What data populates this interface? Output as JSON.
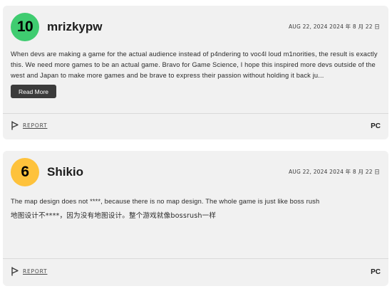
{
  "reviews": [
    {
      "score": "10",
      "score_color": "#3fcc70",
      "username": "mrizkypw",
      "date": "AUG 22, 2024  2024 年 8 月 22 日",
      "body": "When devs are making a game for the actual audience instead of p4ndering to voc4l loud m1norities, the result is exactly this. We need more games to be an actual game. Bravo for Game Science, I hope this inspired more devs outside of the west and Japan to make more games and be brave to express their passion without holding it back ju...",
      "read_more_label": "Read More",
      "report_label": "REPORT",
      "report_icon": "flag-icon",
      "platform": "PC"
    },
    {
      "score": "6",
      "score_color": "#fec23c",
      "username": "Shikio",
      "date": "AUG 22, 2024  2024 年 8 月 22 日",
      "body": "The map design does not ****, because there is no map design. The whole game is just like boss rush",
      "body_translation": "地图设计不****，因为没有地图设计。整个游戏就像bossrush一样",
      "report_label": "REPORT",
      "report_icon": "flag-icon",
      "platform": "PC"
    }
  ]
}
